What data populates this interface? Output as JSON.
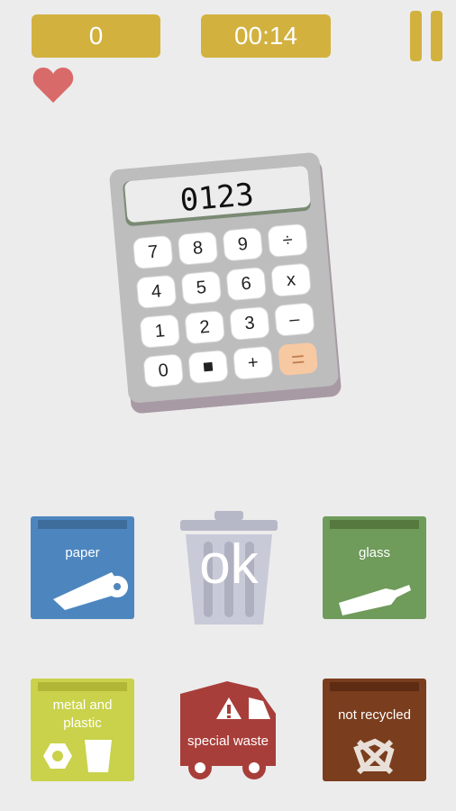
{
  "hud": {
    "score": "0",
    "timer": "00:14",
    "lives": 1
  },
  "item": {
    "name": "calculator",
    "display": "0123",
    "keys": [
      [
        "7",
        "8",
        "9",
        "÷"
      ],
      [
        "4",
        "5",
        "6",
        "x"
      ],
      [
        "1",
        "2",
        "3",
        "–"
      ],
      [
        "0",
        "■",
        "+",
        "="
      ]
    ]
  },
  "bins": {
    "paper": "paper",
    "trash": "ok",
    "glass": "glass",
    "metal": "metal and plastic",
    "special": "special waste",
    "not_recycled": "not recycled"
  },
  "colors": {
    "hud": "#d2b13f",
    "heart": "#d96a6a",
    "paper": "#4d86bf",
    "glass": "#6f9b5b",
    "metal": "#c9d24a",
    "special": "#a83e3a",
    "not_recycled": "#7a3d1d",
    "trash": "#c8cad8"
  }
}
